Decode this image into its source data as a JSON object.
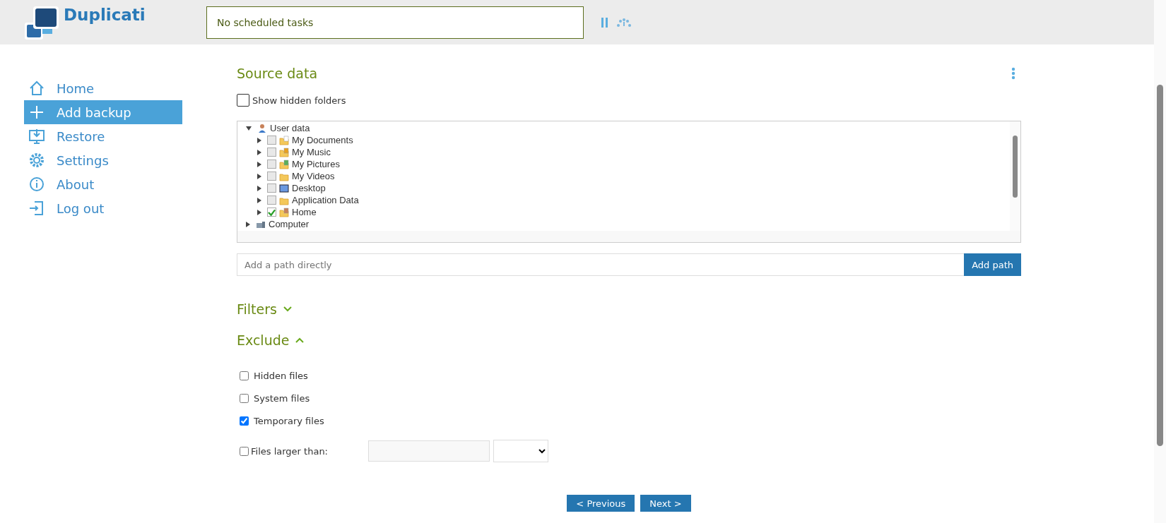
{
  "header": {
    "app_name": "Duplicati",
    "status": "No scheduled tasks"
  },
  "sidebar": {
    "items": [
      {
        "label": "Home",
        "selected": false
      },
      {
        "label": "Add backup",
        "selected": true
      },
      {
        "label": "Restore",
        "selected": false
      },
      {
        "label": "Settings",
        "selected": false
      },
      {
        "label": "About",
        "selected": false
      },
      {
        "label": "Log out",
        "selected": false
      }
    ]
  },
  "source": {
    "title": "Source data",
    "show_hidden": {
      "label": "Show hidden folders",
      "checked": false
    },
    "tree": [
      {
        "label": "User data",
        "expanded": true,
        "children": [
          {
            "label": "My Documents",
            "expanded": false,
            "checked": false
          },
          {
            "label": "My Music",
            "expanded": false,
            "checked": false
          },
          {
            "label": "My Pictures",
            "expanded": false,
            "checked": false
          },
          {
            "label": "My Videos",
            "expanded": false,
            "checked": false
          },
          {
            "label": "Desktop",
            "expanded": false,
            "checked": false
          },
          {
            "label": "Application Data",
            "expanded": false,
            "checked": false
          },
          {
            "label": "Home",
            "expanded": false,
            "checked": true
          }
        ]
      },
      {
        "label": "Computer",
        "expanded": false
      }
    ],
    "path": {
      "placeholder": "Add a path directly",
      "button": "Add path"
    }
  },
  "sections": [
    {
      "title": "Filters",
      "expanded": false
    },
    {
      "title": "Exclude",
      "expanded": true
    }
  ],
  "exclude": [
    {
      "label": "Hidden files",
      "checked": false
    },
    {
      "label": "System files",
      "checked": false
    },
    {
      "label": "Temporary files",
      "checked": true
    }
  ],
  "size_limit": {
    "label": "Files larger than:",
    "checked": false
  },
  "buttons": [
    "< Previous",
    "Next >"
  ]
}
